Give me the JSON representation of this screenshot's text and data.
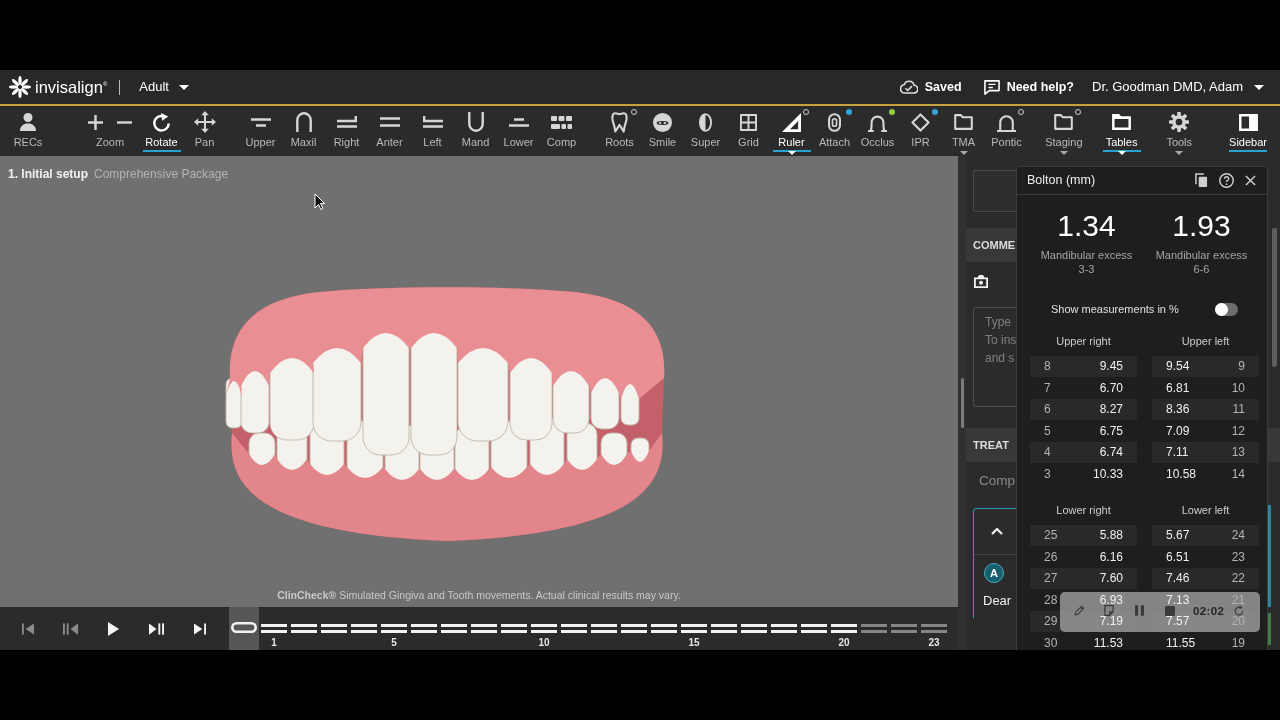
{
  "header": {
    "brand": "invisalign$^{®}$",
    "patient_type": "Adult",
    "save_status": "Saved",
    "help_link": "Need help?",
    "user_menu": "Dr. Goodman DMD, Adam"
  },
  "toolbar": {
    "groups": [
      {
        "items": [
          {
            "label": "RECs",
            "selected": false,
            "dropdown": false
          }
        ]
      },
      {
        "items": [
          {
            "label": "Zoom",
            "selected": false,
            "dropdown": false
          },
          {
            "label": "Rotate",
            "selected": true,
            "dropdown": false
          },
          {
            "label": "Pan",
            "selected": false,
            "dropdown": false
          }
        ]
      },
      {
        "items": [
          {
            "label": "Upper",
            "selected": false,
            "dropdown": false
          },
          {
            "label": "Maxil",
            "selected": false,
            "dropdown": false
          },
          {
            "label": "Right",
            "selected": false,
            "dropdown": false
          },
          {
            "label": "Anter",
            "selected": false,
            "dropdown": false
          },
          {
            "label": "Left",
            "selected": false,
            "dropdown": false
          },
          {
            "label": "Mand",
            "selected": false,
            "dropdown": false
          },
          {
            "label": "Lower",
            "selected": false,
            "dropdown": false
          },
          {
            "label": "Comp",
            "selected": false,
            "dropdown": false
          }
        ]
      },
      {
        "items": [
          {
            "label": "Roots",
            "selected": false,
            "dropdown": false,
            "badge": {
              "kind": "ring"
            }
          },
          {
            "label": "Smile",
            "selected": false,
            "dropdown": false
          },
          {
            "label": "Super",
            "selected": false,
            "dropdown": false
          },
          {
            "label": "Grid",
            "selected": false,
            "dropdown": false
          },
          {
            "label": "Ruler",
            "selected": true,
            "dropdown": true,
            "badge": {
              "kind": "ring"
            }
          },
          {
            "label": "Attach",
            "selected": false,
            "dropdown": false,
            "badge": {
              "kind": "dot",
              "color": "#2fa6d6"
            }
          },
          {
            "label": "Occlus",
            "selected": false,
            "dropdown": false,
            "badge": {
              "kind": "dot",
              "color": "#8dd03f"
            }
          },
          {
            "label": "IPR",
            "selected": false,
            "dropdown": false,
            "badge": {
              "kind": "dot",
              "color": "#2fa6d6"
            }
          },
          {
            "label": "TMA",
            "selected": false,
            "dropdown": true
          },
          {
            "label": "Pontic",
            "selected": false,
            "dropdown": false,
            "badge": {
              "kind": "ring"
            }
          }
        ]
      },
      {
        "items": [
          {
            "label": "Staging",
            "selected": false,
            "dropdown": true,
            "badge": {
              "kind": "ring"
            }
          },
          {
            "label": "Tables",
            "selected": true,
            "dropdown": true
          },
          {
            "label": "Tools",
            "selected": false,
            "dropdown": true
          }
        ]
      },
      {
        "items": [
          {
            "label": "Sidebar",
            "selected": true,
            "dropdown": false
          }
        ]
      }
    ]
  },
  "viewport": {
    "step_title": "1. Initial setup",
    "package_name": "Comprehensive Package",
    "disclaimer": "**ClinCheck®** Simulated Gingiva and Tooth movements. Actual clinical results may vary."
  },
  "playback": {
    "controls": [
      {
        "disabled": true
      },
      {
        "disabled": true
      },
      {
        "disabled": false
      },
      {
        "disabled": false
      },
      {
        "disabled": false
      }
    ]
  },
  "timeline": {
    "stages": [
      {
        "selected": true,
        "dimmed": false
      },
      {
        "label": "1",
        "selected": false,
        "dimmed": false
      },
      {
        "selected": false,
        "dimmed": false
      },
      {
        "selected": false,
        "dimmed": false
      },
      {
        "selected": false,
        "dimmed": false
      },
      {
        "label": "5",
        "selected": false,
        "dimmed": false
      },
      {
        "selected": false,
        "dimmed": false
      },
      {
        "selected": false,
        "dimmed": false
      },
      {
        "selected": false,
        "dimmed": false
      },
      {
        "selected": false,
        "dimmed": false
      },
      {
        "label": "10",
        "selected": false,
        "dimmed": false
      },
      {
        "selected": false,
        "dimmed": false
      },
      {
        "selected": false,
        "dimmed": false
      },
      {
        "selected": false,
        "dimmed": false
      },
      {
        "selected": false,
        "dimmed": false
      },
      {
        "label": "15",
        "selected": false,
        "dimmed": false
      },
      {
        "selected": false,
        "dimmed": false
      },
      {
        "selected": false,
        "dimmed": false
      },
      {
        "selected": false,
        "dimmed": false
      },
      {
        "selected": false,
        "dimmed": false
      },
      {
        "label": "20",
        "selected": false,
        "dimmed": false
      },
      {
        "selected": false,
        "dimmed": true
      },
      {
        "selected": false,
        "dimmed": true
      },
      {
        "label": "23",
        "selected": false,
        "dimmed": true
      }
    ]
  },
  "sidebar": {
    "section_1": {
      "title": "COMME"
    },
    "comment_field": {
      "placeholder": "Type\nTo ins\nand s"
    },
    "section_2": {
      "title": "TREAT"
    },
    "section_2_text": "Comp",
    "message": {
      "avatar_initial": "A",
      "text": "Dear"
    }
  },
  "bolton_panel": {
    "title": "Bolton (mm)",
    "summary": [
      {
        "value": "1.34",
        "label": "Mandibular excess",
        "range": "3-3"
      },
      {
        "value": "1.93",
        "label": "Mandibular excess",
        "range": "6-6"
      }
    ],
    "percent_toggle": {
      "label": "Show measurements in %",
      "on": false
    },
    "arches": [
      {
        "quadrants": [
          {
            "title": "Upper right",
            "rows": [
              {
                "tooth": "8",
                "value": "9.45"
              },
              {
                "tooth": "7",
                "value": "6.70"
              },
              {
                "tooth": "6",
                "value": "8.27"
              },
              {
                "tooth": "5",
                "value": "6.75"
              },
              {
                "tooth": "4",
                "value": "6.74"
              },
              {
                "tooth": "3",
                "value": "10.33"
              }
            ]
          },
          {
            "title": "Upper left",
            "rows": [
              {
                "tooth": "9",
                "value": "9.54"
              },
              {
                "tooth": "10",
                "value": "6.81"
              },
              {
                "tooth": "11",
                "value": "8.36"
              },
              {
                "tooth": "12",
                "value": "7.09"
              },
              {
                "tooth": "13",
                "value": "7.11"
              },
              {
                "tooth": "14",
                "value": "10.58"
              }
            ]
          }
        ]
      },
      {
        "quadrants": [
          {
            "title": "Lower right",
            "rows": [
              {
                "tooth": "25",
                "value": "5.88"
              },
              {
                "tooth": "26",
                "value": "6.16"
              },
              {
                "tooth": "27",
                "value": "7.60"
              },
              {
                "tooth": "28",
                "value": "6.93"
              },
              {
                "tooth": "29",
                "value": "7.19"
              },
              {
                "tooth": "30",
                "value": "11.53"
              }
            ]
          },
          {
            "title": "Lower left",
            "rows": [
              {
                "tooth": "24",
                "value": "5.67"
              },
              {
                "tooth": "23",
                "value": "6.51"
              },
              {
                "tooth": "22",
                "value": "7.46"
              },
              {
                "tooth": "21",
                "value": "7.13"
              },
              {
                "tooth": "20",
                "value": "7.57"
              },
              {
                "tooth": "19",
                "value": "11.55"
              }
            ]
          }
        ]
      }
    ]
  },
  "recording_bar": {
    "time": "02:02"
  }
}
